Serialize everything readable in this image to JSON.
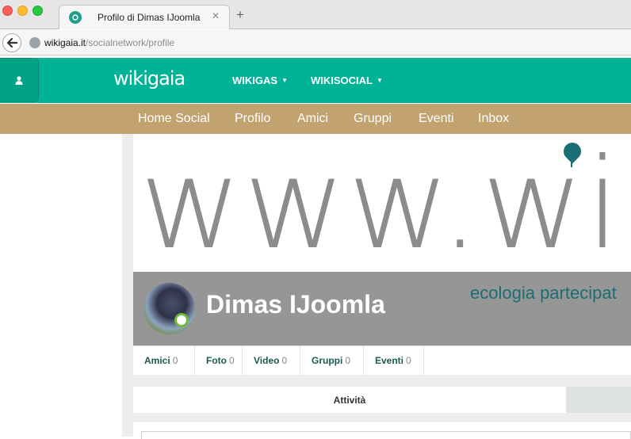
{
  "browser": {
    "tab_title": "Profilo di Dimas IJoomla",
    "tab_close": "✕",
    "new_tab": "+",
    "url_host": "wikigaia.it",
    "url_path": "/socialnetwork/profile"
  },
  "header": {
    "logo_text": "wikigaia",
    "menu": [
      {
        "label": "WIKIGAS"
      },
      {
        "label": "WIKISOCIAL"
      }
    ]
  },
  "subnav": {
    "items": [
      {
        "label": "Home Social"
      },
      {
        "label": "Profilo"
      },
      {
        "label": "Amici"
      },
      {
        "label": "Gruppi"
      },
      {
        "label": "Eventi"
      },
      {
        "label": "Inbox"
      }
    ]
  },
  "cover": {
    "big_text": "www.wik",
    "tagline_part1": "ecologia",
    "tagline_part2": " partecipat"
  },
  "profile": {
    "name": "Dimas IJoomla"
  },
  "stats": [
    {
      "label": "Amici",
      "count": "0"
    },
    {
      "label": "Foto",
      "count": "0"
    },
    {
      "label": "Video",
      "count": "0"
    },
    {
      "label": "Gruppi",
      "count": "0"
    },
    {
      "label": "Eventi",
      "count": "0"
    }
  ],
  "tabs": {
    "active": "Attività"
  },
  "colors": {
    "accent_green": "#00b296",
    "subnav_tan": "#c2a26e",
    "brand_dark_teal": "#1a6e74"
  }
}
